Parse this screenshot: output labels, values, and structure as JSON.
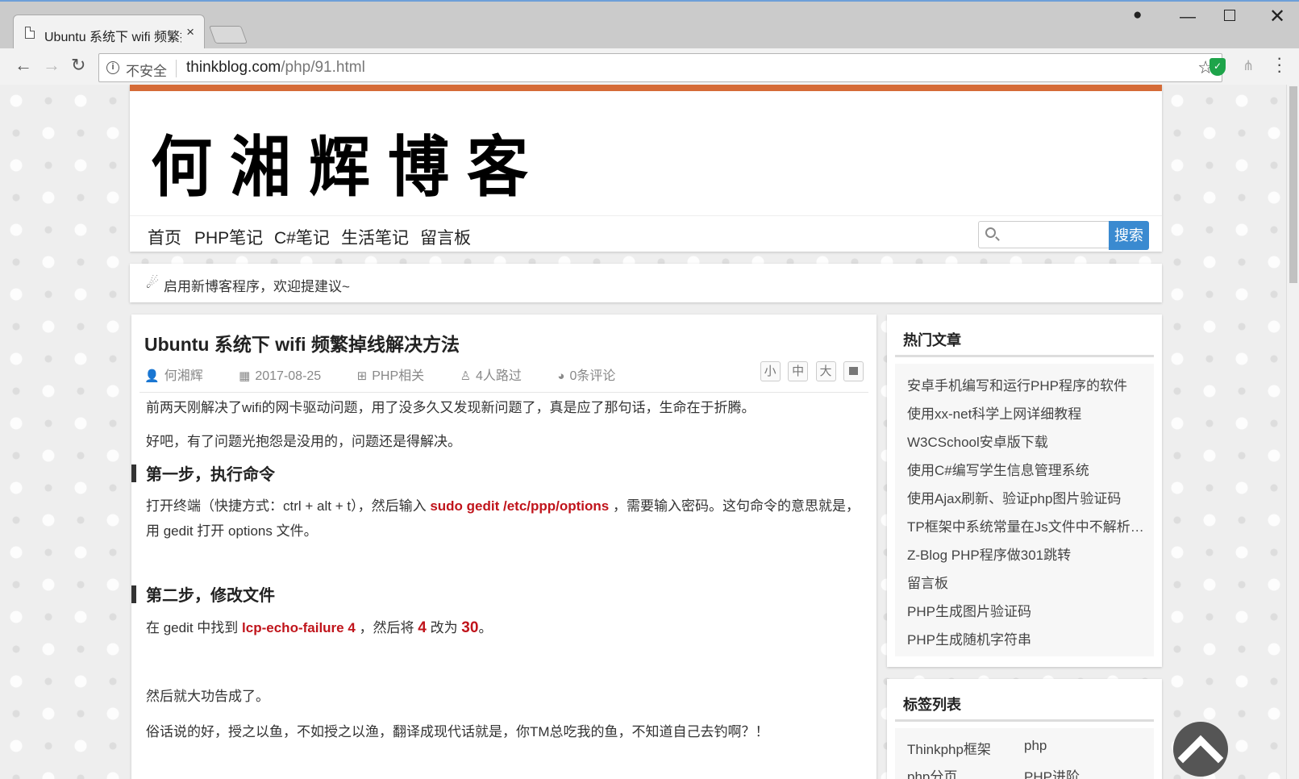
{
  "browser": {
    "tab_title": "Ubuntu 系统下 wifi 频繁掉线解决方法",
    "tab_close": "×",
    "insecure_label": "不安全",
    "url_host": "thinkblog.com",
    "url_path": "/php/91.html"
  },
  "site": {
    "logo_text": "何湘辉博客",
    "nav": [
      "首页",
      "PHP笔记",
      "C#笔记",
      "生活笔记",
      "留言板"
    ],
    "search_placeholder": "",
    "search_button": "搜索",
    "notice": "启用新博客程序，欢迎提建议~",
    "accent_color": "#d56b37"
  },
  "article": {
    "title": "Ubuntu 系统下 wifi 频繁掉线解决方法",
    "meta": {
      "author": "何湘辉",
      "date": "2017-08-25",
      "category": "PHP相关",
      "views": "4人路过",
      "comments": "0条评论"
    },
    "font_sizes": [
      "小",
      "中",
      "大"
    ],
    "p1": "前两天刚解决了wifi的网卡驱动问题，用了没多久又发现新问题了，真是应了那句话，生命在于折腾。",
    "p2": "好吧，有了问题光抱怨是没用的，问题还是得解决。",
    "h2_1": "第一步，执行命令",
    "p3_a": "打开终端（快捷方式：ctrl + alt + t），然后输入 ",
    "p3_cmd": "sudo gedit /etc/ppp/options",
    "p3_b": " ，需要输入密码。这句命令的意思就是，用 gedit 打开 options 文件。",
    "h2_2": "第二步，修改文件",
    "p4_a": "在 gedit 中找到 ",
    "p4_key": "lcp-echo-failure 4",
    "p4_b": " ，然后将 ",
    "p4_from": "4",
    "p4_c": " 改为 ",
    "p4_to": "30",
    "p4_d": "。",
    "p5": "然后就大功告成了。",
    "p6": "俗话说的好，授之以鱼，不如授之以渔，翻译成现代话就是，你TM总吃我的鱼，不知道自己去钓啊？！"
  },
  "sidebar": {
    "hot_title": "热门文章",
    "hot_items": [
      "安卓手机编写和运行PHP程序的软件",
      "使用xx-net科学上网详细教程",
      "W3CSchool安卓版下载",
      "使用C#编写学生信息管理系统",
      "使用Ajax刷新、验证php图片验证码",
      "TP框架中系统常量在Js文件中不解析的问题",
      "Z-Blog PHP程序做301跳转",
      "留言板",
      "PHP生成图片验证码",
      "PHP生成随机字符串"
    ],
    "tags_title": "标签列表",
    "tags": [
      "Thinkphp框架",
      "php",
      "php分页",
      "PHP进阶"
    ]
  }
}
